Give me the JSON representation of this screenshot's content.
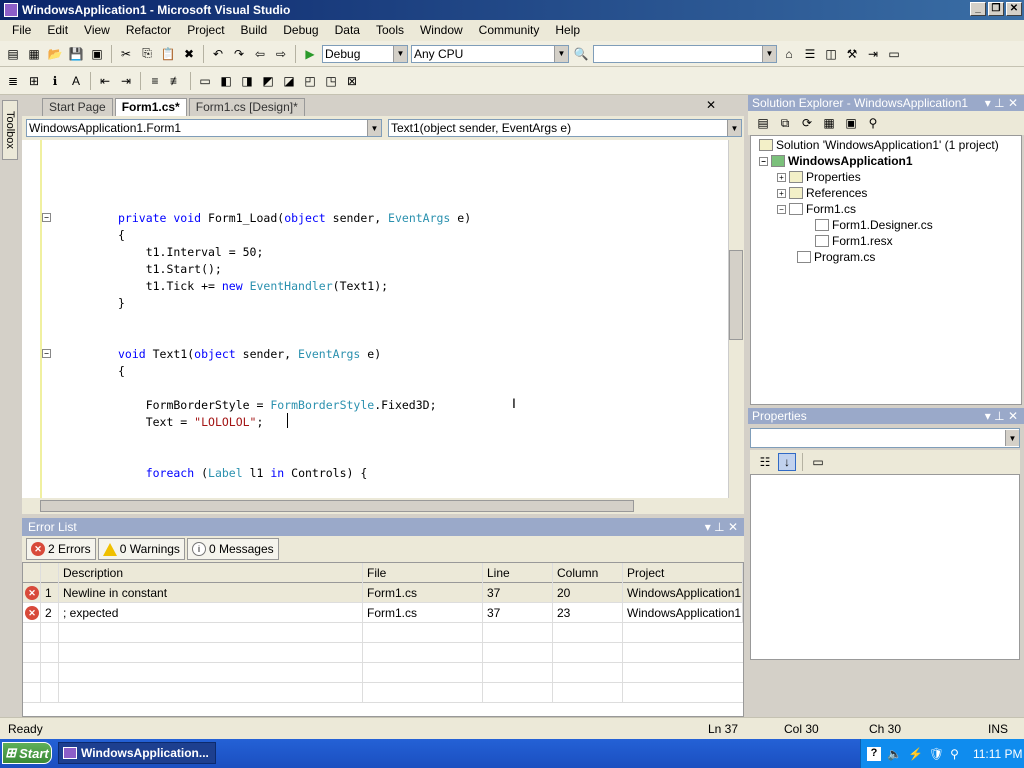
{
  "window": {
    "title": "WindowsApplication1 - Microsoft Visual Studio"
  },
  "menu": {
    "items": [
      "File",
      "Edit",
      "View",
      "Refactor",
      "Project",
      "Build",
      "Debug",
      "Data",
      "Tools",
      "Window",
      "Community",
      "Help"
    ]
  },
  "toolbar": {
    "config": "Debug",
    "platform": "Any CPU",
    "find": ""
  },
  "toolbox": {
    "label": "Toolbox"
  },
  "editor": {
    "tabs": [
      {
        "label": "Start Page"
      },
      {
        "label": "Form1.cs*"
      },
      {
        "label": "Form1.cs [Design]*"
      }
    ],
    "class_combo": "WindowsApplication1.Form1",
    "member_combo": "Text1(object sender, EventArgs e)",
    "code": [
      {
        "parts": [
          {
            "t": "private void ",
            "c": "kw"
          },
          {
            "t": "Form1_Load(",
            "c": ""
          },
          {
            "t": "object",
            "c": "kw"
          },
          {
            "t": " sender, ",
            "c": ""
          },
          {
            "t": "EventArgs",
            "c": "ty"
          },
          {
            "t": " e)",
            "c": ""
          }
        ]
      },
      {
        "parts": [
          {
            "t": "{",
            "c": ""
          }
        ]
      },
      {
        "parts": [
          {
            "t": "    t1.Interval = 50;",
            "c": ""
          }
        ]
      },
      {
        "parts": [
          {
            "t": "    t1.Start();",
            "c": ""
          }
        ]
      },
      {
        "parts": [
          {
            "t": "    t1.Tick += ",
            "c": ""
          },
          {
            "t": "new ",
            "c": "kw"
          },
          {
            "t": "EventHandler",
            "c": "ty"
          },
          {
            "t": "(Text1);",
            "c": ""
          }
        ]
      },
      {
        "parts": [
          {
            "t": "}",
            "c": ""
          }
        ]
      },
      {
        "parts": [
          {
            "t": "void ",
            "c": "kw"
          },
          {
            "t": "Text1(",
            "c": ""
          },
          {
            "t": "object",
            "c": "kw"
          },
          {
            "t": " sender, ",
            "c": ""
          },
          {
            "t": "EventArgs",
            "c": "ty"
          },
          {
            "t": " e)",
            "c": ""
          }
        ]
      },
      {
        "parts": [
          {
            "t": "{",
            "c": ""
          }
        ]
      },
      {
        "parts": [
          {
            "t": "    FormBorderStyle = ",
            "c": ""
          },
          {
            "t": "FormBorderStyle",
            "c": "ty"
          },
          {
            "t": ".Fixed3D;",
            "c": ""
          }
        ]
      },
      {
        "parts": [
          {
            "t": "    Text = ",
            "c": ""
          },
          {
            "t": "\"LOLOLOL\"",
            "c": "str"
          },
          {
            "t": ";",
            "c": ""
          }
        ]
      },
      {
        "parts": [
          {
            "t": "    foreach ",
            "c": "kw"
          },
          {
            "t": "(",
            "c": ""
          },
          {
            "t": "Label",
            "c": "ty"
          },
          {
            "t": " l1 ",
            "c": ""
          },
          {
            "t": "in",
            "c": "kw"
          },
          {
            "t": " Controls) {",
            "c": ""
          }
        ]
      }
    ]
  },
  "error_list": {
    "title": "Error List",
    "errors_btn": "2 Errors",
    "warnings_btn": "0 Warnings",
    "messages_btn": "0 Messages",
    "columns": [
      "Description",
      "File",
      "Line",
      "Column",
      "Project"
    ],
    "rows": [
      {
        "num": "1",
        "description": "Newline in constant",
        "file": "Form1.cs",
        "line": "37",
        "column": "20",
        "project": "WindowsApplication1"
      },
      {
        "num": "2",
        "description": "; expected",
        "file": "Form1.cs",
        "line": "37",
        "column": "23",
        "project": "WindowsApplication1"
      }
    ]
  },
  "solution_explorer": {
    "title": "Solution Explorer - WindowsApplication1",
    "nodes": [
      {
        "label": "Solution 'WindowsApplication1' (1 project)",
        "bold": false
      },
      {
        "label": "WindowsApplication1",
        "bold": true
      },
      {
        "label": "Properties",
        "bold": false
      },
      {
        "label": "References",
        "bold": false
      },
      {
        "label": "Form1.cs",
        "bold": false
      },
      {
        "label": "Form1.Designer.cs",
        "bold": false
      },
      {
        "label": "Form1.resx",
        "bold": false
      },
      {
        "label": "Program.cs",
        "bold": false
      }
    ]
  },
  "properties": {
    "title": "Properties"
  },
  "status": {
    "ready": "Ready",
    "ln": "Ln 37",
    "col": "Col 30",
    "ch": "Ch 30",
    "ins": "INS"
  },
  "taskbar": {
    "start": "Start",
    "item": "WindowsApplication...",
    "clock": "11:11 PM"
  },
  "colors": {
    "keyword": "#0000ff",
    "type": "#2b91af",
    "string": "#a31515",
    "title_bar": "#0a246a"
  }
}
